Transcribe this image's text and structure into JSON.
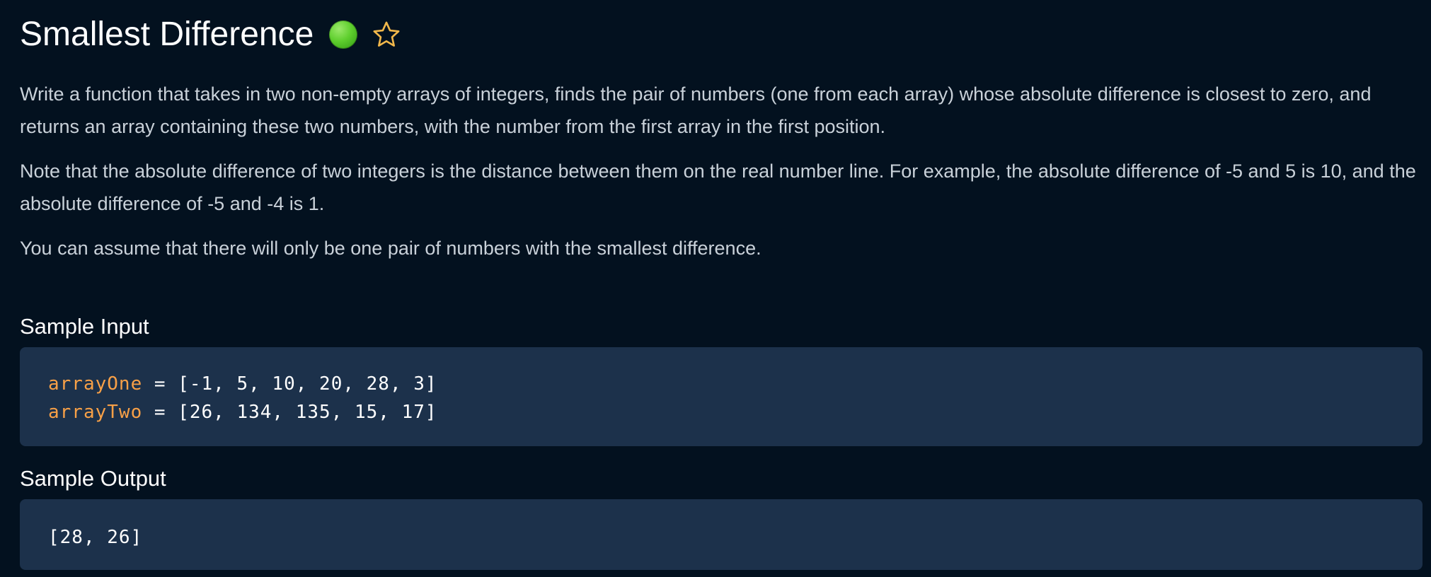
{
  "header": {
    "title": "Smallest Difference",
    "difficulty_color": "#5fcf2e",
    "difficulty_icon": "green-dot-icon",
    "favorite_icon": "star-outline-icon",
    "favorite_color": "#f2b84b"
  },
  "description": {
    "paragraph_1": "Write a function that takes in two non-empty arrays of integers, finds the pair of numbers (one from each array) whose absolute difference is closest to zero, and returns an array containing these two numbers, with the number from the first array in the first position.",
    "paragraph_2": "Note that the absolute difference of two integers is the distance between them on the real number line. For example, the absolute difference of -5 and 5 is 10, and the absolute difference of -5 and -4 is 1.",
    "paragraph_3": "You can assume that there will only be one pair of numbers with the smallest difference."
  },
  "sample_input": {
    "heading": "Sample Input",
    "lines": [
      {
        "var": "arrayOne",
        "value": " = [-1, 5, 10, 20, 28, 3]"
      },
      {
        "var": "arrayTwo",
        "value": " = [26, 134, 135, 15, 17]"
      }
    ]
  },
  "sample_output": {
    "heading": "Sample Output",
    "value": "[28, 26]"
  },
  "colors": {
    "background": "#03111f",
    "code_background": "#1c314b",
    "variable": "#f7a047",
    "text": "#c9d1d9"
  }
}
